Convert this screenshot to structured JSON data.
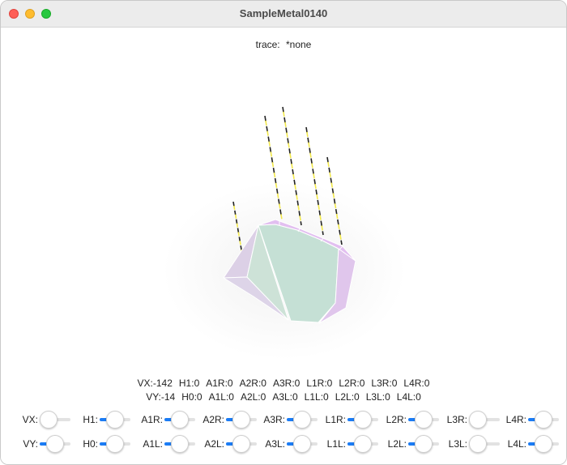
{
  "window": {
    "title": "SampleMetal0140"
  },
  "trace": {
    "label": "trace:",
    "value": "*none"
  },
  "readout": {
    "row1": [
      "VX:-142",
      "H1:0",
      "A1R:0",
      "A2R:0",
      "A3R:0",
      "L1R:0",
      "L2R:0",
      "L3R:0",
      "L4R:0"
    ],
    "row2": [
      "VY:-14",
      "H0:0",
      "A1L:0",
      "A2L:0",
      "A3L:0",
      "L1L:0",
      "L2L:0",
      "L3L:0",
      "L4L:0"
    ]
  },
  "sliders": {
    "row1": [
      {
        "label": "VX:",
        "value": 0.0
      },
      {
        "label": "H1:",
        "value": 0.5
      },
      {
        "label": "A1R:",
        "value": 0.5
      },
      {
        "label": "A2R:",
        "value": 0.5
      },
      {
        "label": "A3R:",
        "value": 0.5
      },
      {
        "label": "L1R:",
        "value": 0.5
      },
      {
        "label": "L2R:",
        "value": 0.5
      },
      {
        "label": "L3R:",
        "value": 0.0
      },
      {
        "label": "L4R:",
        "value": 0.5
      }
    ],
    "row2": [
      {
        "label": "VY:",
        "value": 0.5
      },
      {
        "label": "H0:",
        "value": 0.5
      },
      {
        "label": "A1L:",
        "value": 0.5
      },
      {
        "label": "A2L:",
        "value": 0.5
      },
      {
        "label": "A3L:",
        "value": 0.5
      },
      {
        "label": "L1L:",
        "value": 0.5
      },
      {
        "label": "L2L:",
        "value": 0.5
      },
      {
        "label": "L3L:",
        "value": 0.0
      },
      {
        "label": "L4L:",
        "value": 0.5
      }
    ]
  },
  "colors": {
    "accent": "#1b7cf5",
    "face_green": "#c5e0d5",
    "face_lilac": "#dcd0e6",
    "edge_pink": "#e2bff0",
    "lamp_yellow": "#f2e84a"
  }
}
